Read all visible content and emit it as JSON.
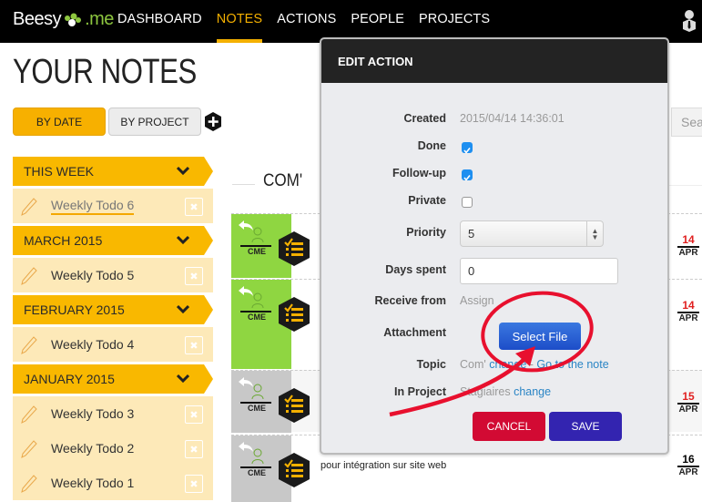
{
  "app": {
    "logo_text": "Beesy",
    "logo_suffix": ".me"
  },
  "nav": {
    "items": [
      {
        "label": "DASHBOARD",
        "active": false
      },
      {
        "label": "NOTES",
        "active": true
      },
      {
        "label": "ACTIONS",
        "active": false
      },
      {
        "label": "PEOPLE",
        "active": false
      },
      {
        "label": "PROJECTS",
        "active": false
      }
    ]
  },
  "page": {
    "title": "YOUR NOTES",
    "tabs": {
      "by_date": "BY DATE",
      "by_project": "BY PROJECT"
    },
    "search_placeholder": "Sea",
    "section_title": "COM'"
  },
  "sidebar": {
    "groups": [
      {
        "label": "THIS WEEK",
        "notes": [
          {
            "label": "Weekly Todo 6",
            "current": true
          }
        ]
      },
      {
        "label": "MARCH 2015",
        "notes": [
          {
            "label": "Weekly Todo 5"
          }
        ]
      },
      {
        "label": "FEBRUARY 2015",
        "notes": [
          {
            "label": "Weekly Todo 4"
          }
        ]
      },
      {
        "label": "JANUARY 2015",
        "notes": [
          {
            "label": "Weekly Todo 3"
          },
          {
            "label": "Weekly Todo 2"
          },
          {
            "label": "Weekly Todo 1"
          }
        ]
      }
    ]
  },
  "actions": [
    {
      "assignee": "CME",
      "status": "done",
      "day": "14",
      "month": "APR",
      "overdue": true
    },
    {
      "assignee": "CME",
      "status": "done",
      "day": "14",
      "month": "APR",
      "overdue": true
    },
    {
      "assignee": "CME",
      "status": "pending",
      "day": "15",
      "month": "APR",
      "overdue": true
    },
    {
      "assignee": "CME",
      "status": "pending",
      "day": "16",
      "month": "APR",
      "overdue": false,
      "text": "pour intégration sur site web"
    }
  ],
  "modal": {
    "title": "EDIT ACTION",
    "fields": {
      "created_label": "Created",
      "created_value": "2015/04/14 14:36:01",
      "done_label": "Done",
      "done_checked": true,
      "followup_label": "Follow-up",
      "followup_checked": true,
      "private_label": "Private",
      "private_checked": false,
      "priority_label": "Priority",
      "priority_value": "5",
      "days_label": "Days spent",
      "days_value": "0",
      "receive_label": "Receive from",
      "receive_value": "Assign",
      "attachment_label": "Attachment",
      "select_file": "Select File",
      "topic_label": "Topic",
      "topic_value": "Com'",
      "topic_change": "change",
      "topic_sep": "-",
      "topic_goto": "Go to the note",
      "project_label": "In Project",
      "project_value": "Stagiaires",
      "project_change": "change"
    },
    "cancel": "CANCEL",
    "save": "SAVE"
  },
  "colors": {
    "accent": "#f4b000",
    "done_green": "#8fd641",
    "pending_gray": "#c8c8c8",
    "overdue_red": "#e02020",
    "annotation": "#e8102e"
  }
}
